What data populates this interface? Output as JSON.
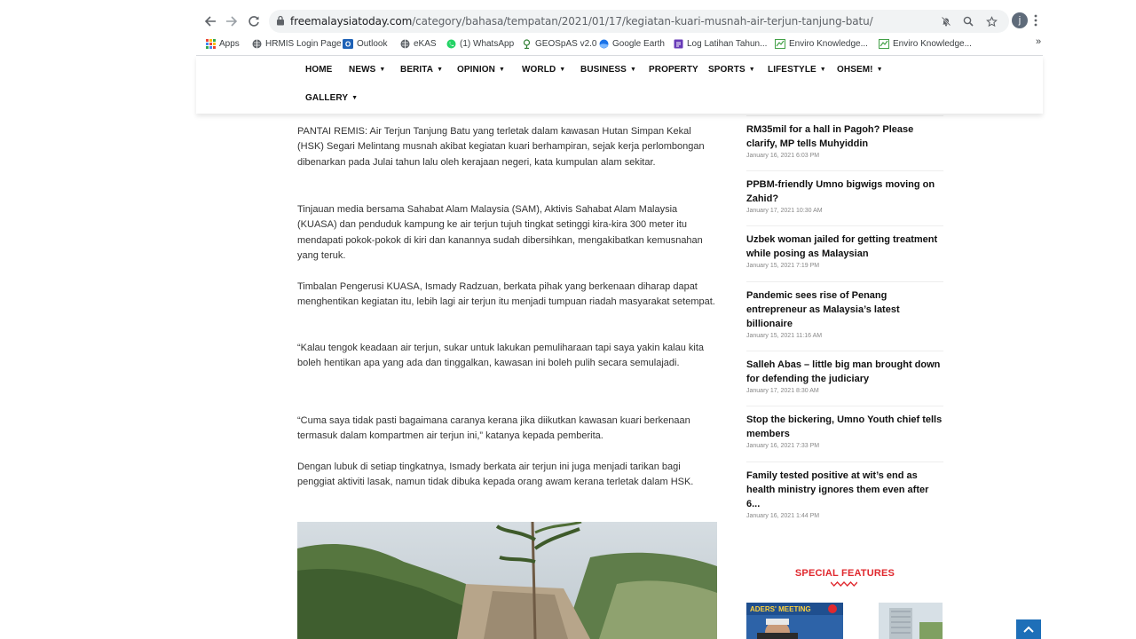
{
  "browser": {
    "url_host": "freemalaysiatoday.com",
    "url_path": "/category/bahasa/tempatan/2021/01/17/kegiatan-kuari-musnah-air-terjun-tanjung-batu/",
    "profile_initial": "j",
    "bookmarks": [
      {
        "label": "Apps",
        "icon": "apps-grid-icon",
        "color": "#ea4335"
      },
      {
        "label": "HRMIS Login Page",
        "icon": "globe-icon",
        "color": "#5f6368"
      },
      {
        "label": "Outlook",
        "icon": "outlook-icon",
        "color": "#1e62b6"
      },
      {
        "label": "eKAS",
        "icon": "globe-icon",
        "color": "#5f6368"
      },
      {
        "label": "(1) WhatsApp",
        "icon": "whatsapp-icon",
        "color": "#25d366"
      },
      {
        "label": "GEOSpAS v2.0",
        "icon": "geospas-icon",
        "color": "#2e7d32"
      },
      {
        "label": "Google Earth",
        "icon": "google-earth-icon",
        "color": "#1a73e8"
      },
      {
        "label": "Log Latihan Tahun...",
        "icon": "form-icon",
        "color": "#673ab7"
      },
      {
        "label": "Enviro Knowledge...",
        "icon": "enviro-icon",
        "color": "#43a047"
      },
      {
        "label": "Enviro Knowledge...",
        "icon": "enviro-icon",
        "color": "#43a047"
      }
    ],
    "more_bookmarks": "»"
  },
  "site_nav": {
    "items": [
      {
        "label": "HOME",
        "dropdown": false
      },
      {
        "label": "NEWS",
        "dropdown": true
      },
      {
        "label": "BERITA",
        "dropdown": true
      },
      {
        "label": "OPINION",
        "dropdown": true
      },
      {
        "label": "WORLD",
        "dropdown": true
      },
      {
        "label": "BUSINESS",
        "dropdown": true
      },
      {
        "label": "PROPERTY",
        "dropdown": false
      },
      {
        "label": "SPORTS",
        "dropdown": true
      },
      {
        "label": "LIFESTYLE",
        "dropdown": true
      },
      {
        "label": "OHSEM!",
        "dropdown": true
      },
      {
        "label": "GALLERY",
        "dropdown": true
      }
    ],
    "caret": "▼"
  },
  "article": {
    "paragraphs": [
      "PANTAI REMIS: Air Terjun Tanjung Batu yang terletak dalam kawasan Hutan Simpan Kekal (HSK) Segari Melintang musnah akibat kegiatan kuari berhampiran, sejak kerja perlombongan dibenarkan pada Julai tahun lalu oleh kerajaan negeri, kata kumpulan alam sekitar.",
      "Tinjauan media bersama Sahabat Alam Malaysia (SAM), Aktivis Sahabat Alam Malaysia (KUASA) dan penduduk kampung ke air terjun tujuh tingkat setinggi kira-kira 300 meter itu mendapati pokok-pokok di kiri dan kanannya sudah dibersihkan, mengakibatkan kemusnahan yang teruk.",
      "Timbalan Pengerusi KUASA, Ismady Radzuan, berkata pihak yang berkenaan diharap dapat menghentikan kegiatan itu, lebih lagi air terjun itu menjadi tumpuan riadah masyarakat setempat.",
      "“Kalau tengok keadaan air terjun, sukar untuk lakukan pemuliharaan tapi saya yakin kalau kita boleh hentikan apa yang ada dan tinggalkan, kawasan ini boleh pulih secara semulajadi.",
      "“Cuma saya tidak pasti bagaimana caranya kerana jika diikutkan kawasan kuari berkenaan termasuk dalam kompartmen air terjun ini,” katanya kepada pemberita.",
      "Dengan lubuk di setiap tingkatnya, Ismady berkata air terjun ini juga menjadi tarikan bagi penggiat aktiviti lasak, namun tidak dibuka kepada orang awam kerana terletak dalam HSK."
    ]
  },
  "sidebar": {
    "news": [
      {
        "title": "RM35mil for a hall in Pagoh? Please clarify, MP tells Muhyiddin",
        "date": "January 16, 2021 6:03 PM"
      },
      {
        "title": "PPBM-friendly Umno bigwigs moving on Zahid?",
        "date": "January 17, 2021 10:30 AM"
      },
      {
        "title": "Uzbek woman jailed for getting treatment while posing as Malaysian",
        "date": "January 15, 2021 7:19 PM"
      },
      {
        "title": "Pandemic sees rise of Penang entrepreneur as Malaysia’s latest billionaire",
        "date": "January 15, 2021 11:16 AM"
      },
      {
        "title": "Salleh Abas – little big man brought down for defending the judiciary",
        "date": "January 17, 2021 8:30 AM"
      },
      {
        "title": "Stop the bickering, Umno Youth chief tells members",
        "date": "January 16, 2021 7:33 PM"
      },
      {
        "title": "Family tested positive at wit’s end as health ministry ignores them even after 6...",
        "date": "January 16, 2021 1:44 PM"
      }
    ],
    "special_features_title": "SPECIAL FEATURES",
    "thumb1_caption": "ADERS' MEETING"
  },
  "colors": {
    "accent_red": "#e0282e",
    "back_to_top": "#1e6fb8"
  }
}
